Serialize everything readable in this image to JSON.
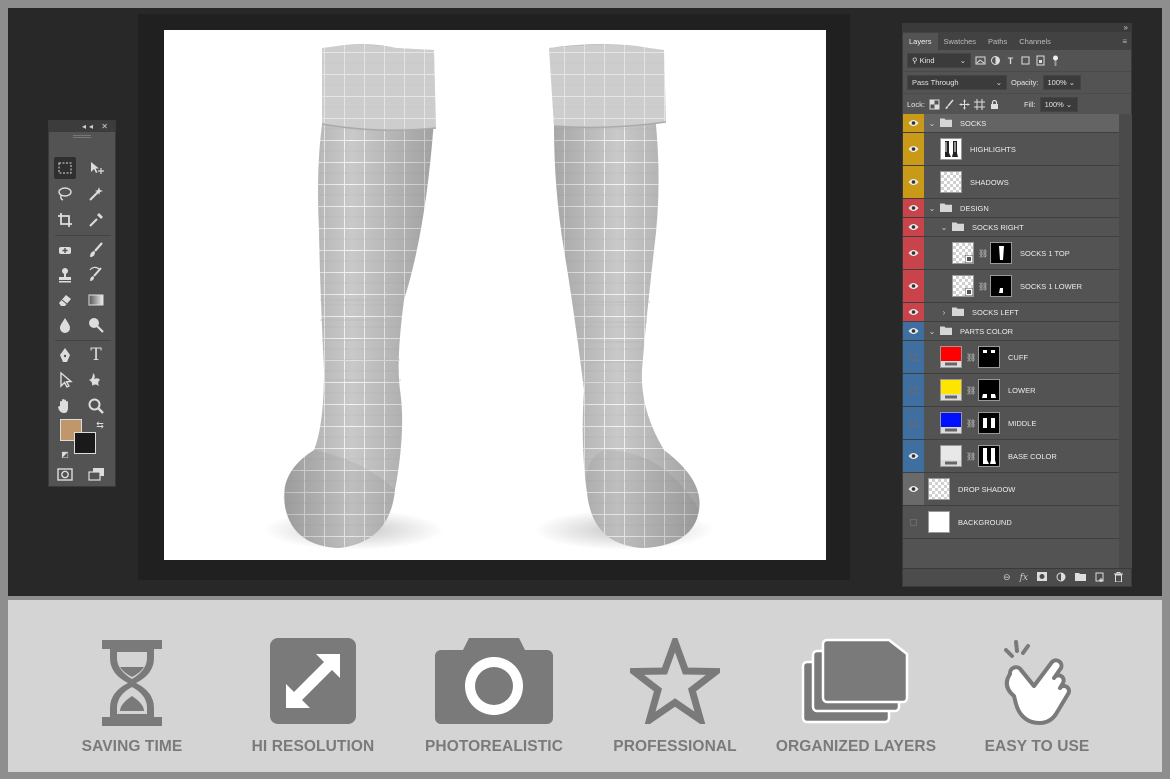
{
  "workspace": {
    "canvas_title": "",
    "toolbox": {
      "header_glyphs": "◂◂ ✕",
      "tools": [
        "rect-marquee",
        "move",
        "lasso",
        "magic-wand",
        "crop",
        "eyedropper",
        "healing-brush",
        "brush",
        "clone-stamp",
        "history-brush",
        "eraser",
        "gradient",
        "blur",
        "dodge",
        "pen",
        "type",
        "path-selection",
        "custom-shape",
        "hand",
        "zoom"
      ],
      "type_tool_glyph": "T",
      "foreground_color": "#c0976a",
      "background_color": "#1a1a1a"
    },
    "layers_panel": {
      "tabs": [
        "Layers",
        "Swatches",
        "Paths",
        "Channels"
      ],
      "filter_kind": "Kind",
      "blend_mode": "Pass Through",
      "opacity_label": "Opacity:",
      "opacity_value": "100%",
      "lock_label": "Lock:",
      "fill_label": "Fill:",
      "fill_value": "100%",
      "layers": [
        {
          "name": "SOCKS",
          "kind": "group",
          "indent": 0,
          "visible": true,
          "tag": "#c99a18",
          "expanded": true,
          "selected": true
        },
        {
          "name": "HIGHLIGHTS",
          "kind": "layer",
          "indent": 1,
          "visible": true,
          "tag": "#c99a18",
          "thumb": "highlights"
        },
        {
          "name": "SHADOWS",
          "kind": "layer",
          "indent": 1,
          "visible": true,
          "tag": "#c99a18",
          "thumb": "checker"
        },
        {
          "name": "DESIGN",
          "kind": "group",
          "indent": 0,
          "visible": true,
          "tag": "#c8434a",
          "expanded": true
        },
        {
          "name": "SOCKS RIGHT",
          "kind": "group",
          "indent": 1,
          "visible": true,
          "tag": "#c8434a",
          "expanded": true
        },
        {
          "name": "SOCKS 1 TOP",
          "kind": "smart",
          "indent": 2,
          "visible": true,
          "tag": "#c8434a",
          "mask": "top"
        },
        {
          "name": "SOCKS 1 LOWER",
          "kind": "smart",
          "indent": 2,
          "visible": true,
          "tag": "#c8434a",
          "mask": "lower"
        },
        {
          "name": "SOCKS LEFT",
          "kind": "group",
          "indent": 1,
          "visible": true,
          "tag": "#c8434a",
          "expanded": false
        },
        {
          "name": "PARTS COLOR",
          "kind": "group",
          "indent": 0,
          "visible": true,
          "tag": "#3f6fa0",
          "expanded": true
        },
        {
          "name": "CUFF",
          "kind": "fill",
          "indent": 1,
          "visible": false,
          "tag": "#3f6fa0",
          "swatch": "#ff0000",
          "mask": "cuff"
        },
        {
          "name": "LOWER",
          "kind": "fill",
          "indent": 1,
          "visible": false,
          "tag": "#3f6fa0",
          "swatch": "#ffe400",
          "mask": "lower2"
        },
        {
          "name": "MIDDLE",
          "kind": "fill",
          "indent": 1,
          "visible": false,
          "tag": "#3f6fa0",
          "swatch": "#0010ff",
          "mask": "middle"
        },
        {
          "name": "BASE COLOR",
          "kind": "fill",
          "indent": 1,
          "visible": true,
          "tag": "#3f6fa0",
          "swatch": "#e8e8e8",
          "mask": "base"
        },
        {
          "name": "DROP SHADOW",
          "kind": "layer",
          "indent": 0,
          "visible": true,
          "tag": "#6a6a6a",
          "thumb": "checker"
        },
        {
          "name": "BACKGROUND",
          "kind": "layer",
          "indent": 0,
          "visible": false,
          "tag": "#535353",
          "thumb": "white"
        }
      ]
    }
  },
  "features": [
    {
      "label": "SAVING TIME",
      "icon": "hourglass-icon"
    },
    {
      "label": "HI RESOLUTION",
      "icon": "expand-arrows-icon"
    },
    {
      "label": "PHOTOREALISTIC",
      "icon": "camera-icon"
    },
    {
      "label": "PROFESSIONAL",
      "icon": "star-icon"
    },
    {
      "label": "ORGANIZED LAYERS",
      "icon": "stacked-layers-icon"
    },
    {
      "label": "EASY TO USE",
      "icon": "tap-hand-icon"
    }
  ],
  "colors": {
    "icon_gray": "#7a7a7a",
    "feature_bg": "#d4d4d4",
    "frame": "#8e8e8e"
  }
}
